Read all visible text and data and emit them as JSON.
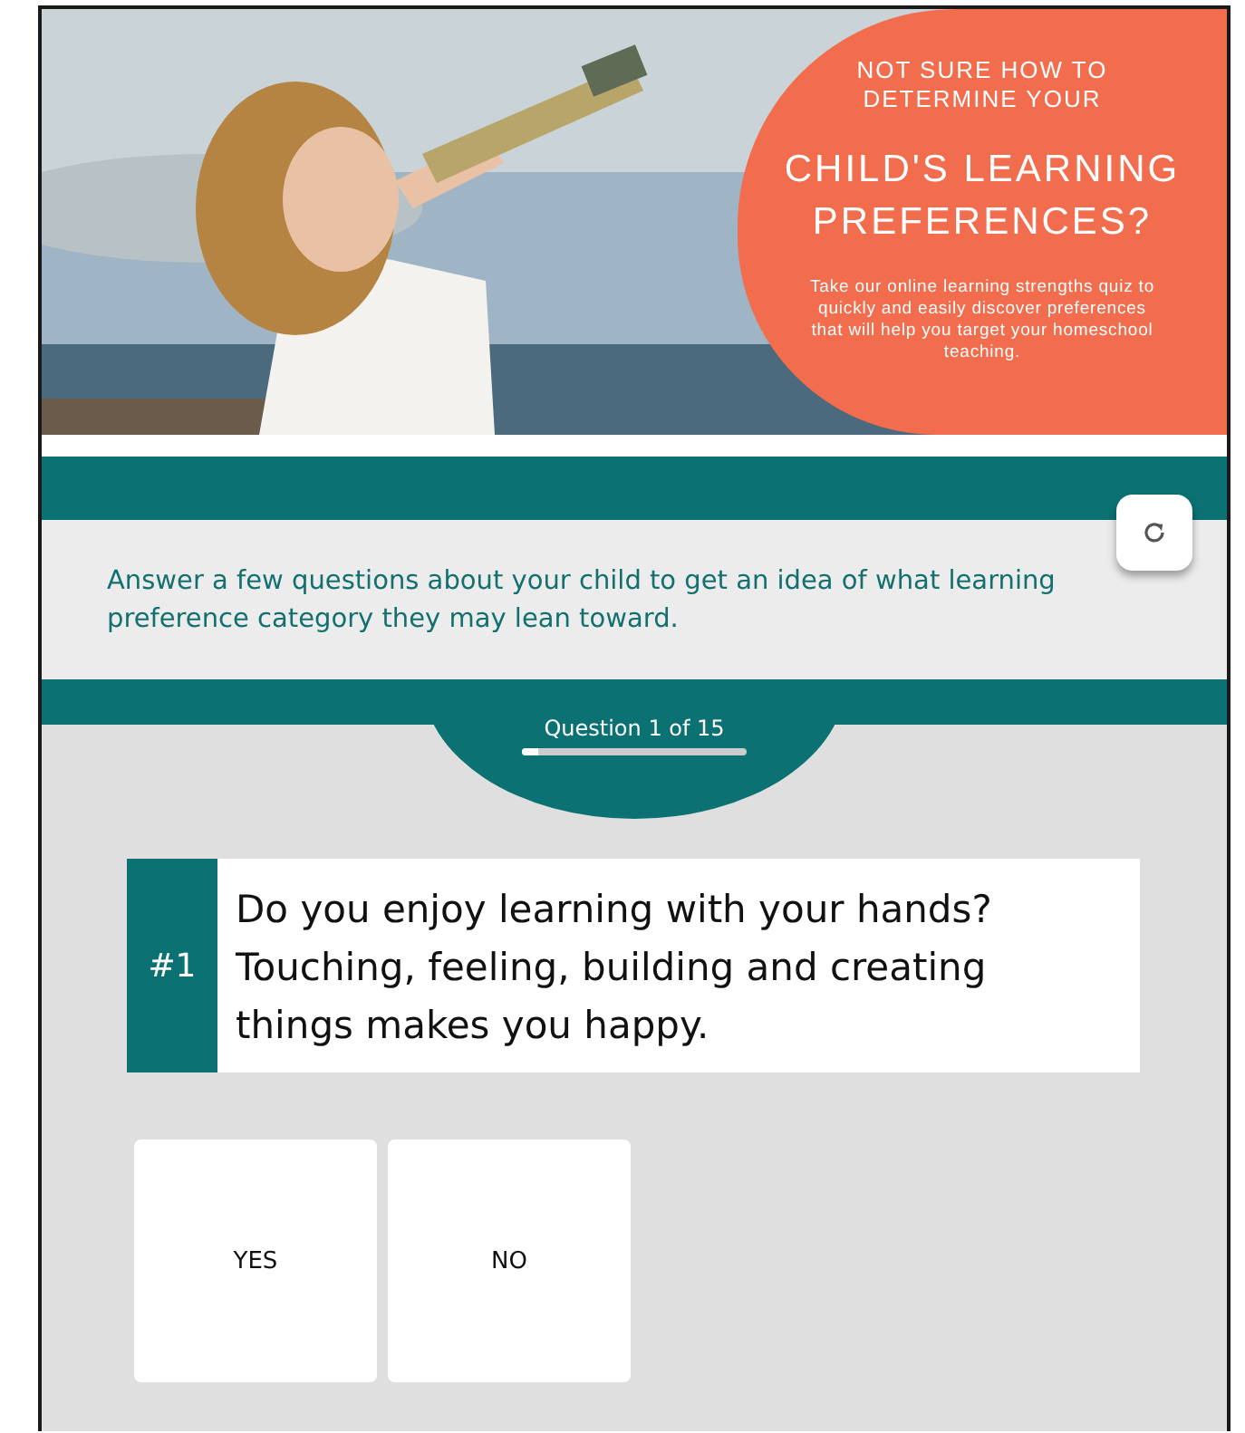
{
  "banner": {
    "lead": "NOT SURE HOW TO DETERMINE YOUR",
    "headline": "CHILD'S LEARNING PREFERENCES?",
    "blurb": "Take our online learning strengths quiz to quickly and easily discover preferences that will help you target your homeschool teaching."
  },
  "intro": "Answer a few questions about your child to get an idea of what learning preference category they may lean toward.",
  "progress": {
    "label": "Question 1 of 15",
    "level": 0.07
  },
  "question": {
    "number": "#1",
    "text": "Do you enjoy learning with your hands? Touching, feeling, building and creating things makes you happy."
  },
  "answers": [
    {
      "label": "YES",
      "selected": false
    },
    {
      "label": "NO",
      "selected": false
    }
  ]
}
